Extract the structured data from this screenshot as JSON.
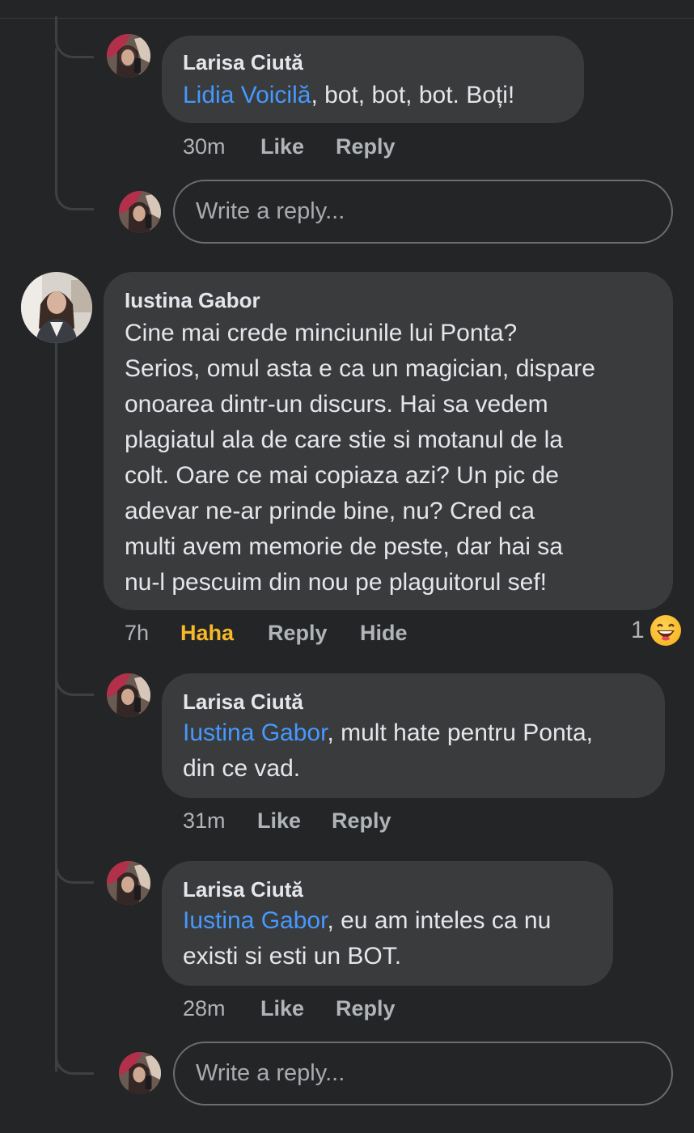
{
  "comments": {
    "c1": {
      "author": "Larisa Ciută",
      "mention": "Lidia Voicilă",
      "text": ", bot, bot, bot. Boți!",
      "time": "30m",
      "like": "Like",
      "reply": "Reply"
    },
    "c2": {
      "author": "Iustina Gabor",
      "lines": [
        "Cine mai crede minciunile lui Ponta?",
        "Serios, omul asta e ca un magician, dispare",
        "onoarea dintr-un discurs. Hai sa vedem",
        "plagiatul ala de care stie si motanul de la",
        "colt. Oare ce mai copiaza azi? Un pic de",
        "adevar ne-ar prinde bine, nu? Cred ca",
        "multi avem memorie de peste, dar hai sa",
        "nu-l pescuim din nou pe plaguitorul sef!"
      ],
      "time": "7h",
      "haha": "Haha",
      "reply": "Reply",
      "hide": "Hide",
      "reaction_count": "1",
      "reaction_icon": "laughing-emoji-icon"
    },
    "c3": {
      "author": "Larisa Ciută",
      "mention": "Iustina Gabor",
      "text_line1": ", mult hate pentru Ponta,",
      "text_line2": "din ce vad.",
      "time": "31m",
      "like": "Like",
      "reply": "Reply"
    },
    "c4": {
      "author": "Larisa Ciută",
      "mention": "Iustina Gabor",
      "text_line1": ", eu am inteles ca nu",
      "text_line2": "existi si esti un BOT.",
      "time": "28m",
      "like": "Like",
      "reply": "Reply"
    }
  },
  "reply_placeholder": "Write a reply...",
  "colors": {
    "background": "#242526",
    "bubble": "#3a3b3c",
    "mention": "#4599ff",
    "haha": "#f7b928",
    "meta": "#b0b3b8"
  }
}
